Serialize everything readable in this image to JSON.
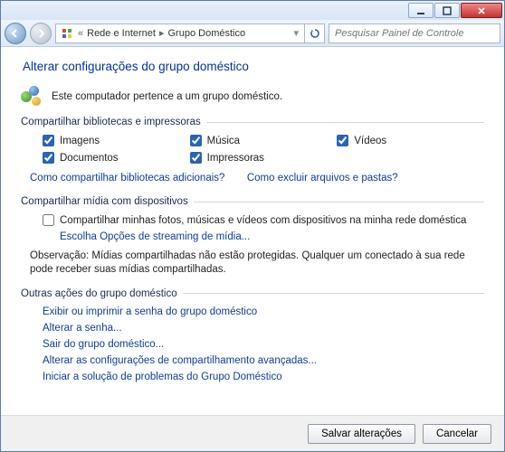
{
  "breadcrumbs": {
    "item1": "Rede e Internet",
    "item2": "Grupo Doméstico"
  },
  "search": {
    "placeholder": "Pesquisar Painel de Controle"
  },
  "title": "Alterar configurações do grupo doméstico",
  "belongs": "Este computador pertence a um grupo doméstico.",
  "section_share_libs": "Compartilhar bibliotecas e impressoras",
  "checks": {
    "imagens": {
      "label": "Imagens",
      "checked": true
    },
    "musica": {
      "label": "Música",
      "checked": true
    },
    "videos": {
      "label": "Vídeos",
      "checked": true
    },
    "documentos": {
      "label": "Documentos",
      "checked": true
    },
    "impressoras": {
      "label": "Impressoras",
      "checked": true
    }
  },
  "links": {
    "libs_more": "Como compartilhar bibliotecas adicionais?",
    "exclude": "Como excluir arquivos e pastas?"
  },
  "section_share_devices": "Compartilhar mídia com dispositivos",
  "share_media": {
    "label": "Compartilhar minhas fotos, músicas e vídeos com dispositivos na minha rede doméstica",
    "checked": false,
    "stream": "Escolha Opções de streaming de mídia..."
  },
  "note": "Observação: Mídias compartilhadas não estão protegidas. Qualquer um conectado à sua rede pode receber suas mídias compartilhadas.",
  "section_other": "Outras ações do grupo doméstico",
  "other": {
    "show_pwd": "Exibir ou imprimir a senha do grupo doméstico",
    "change_pwd": "Alterar a senha...",
    "leave": "Sair do grupo doméstico...",
    "adv": "Alterar as configurações de compartilhamento avançadas...",
    "trouble": "Iniciar a solução de problemas do Grupo Doméstico"
  },
  "footer": {
    "save": "Salvar alterações",
    "cancel": "Cancelar"
  }
}
